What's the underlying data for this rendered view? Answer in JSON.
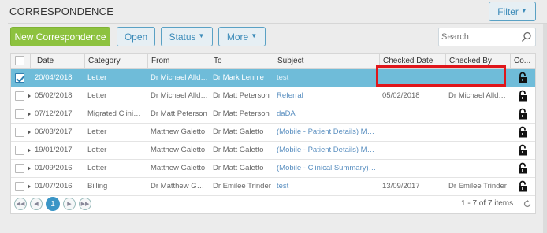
{
  "panel": {
    "title": "CORRESPONDENCE"
  },
  "toolbar": {
    "filter_label": "Filter",
    "new_label": "New Correspondence",
    "open_label": "Open",
    "status_label": "Status",
    "more_label": "More"
  },
  "search": {
    "placeholder": "Search",
    "value": ""
  },
  "table": {
    "columns": [
      "Date",
      "Category",
      "From",
      "To",
      "Subject",
      "Checked Date",
      "Checked By",
      "Co..."
    ],
    "rows": [
      {
        "date": "20/04/2018",
        "category": "Letter",
        "from": "Dr Michael Alldrick",
        "to": "Dr Mark Lennie",
        "subject": "test",
        "checked_date": "",
        "checked_by": "",
        "selected": true
      },
      {
        "date": "05/02/2018",
        "category": "Letter",
        "from": "Dr Michael Alldrick",
        "to": "Dr Matt Peterson",
        "subject": "Referral",
        "checked_date": "05/02/2018",
        "checked_by": "Dr Michael Alldrick",
        "selected": false
      },
      {
        "date": "07/12/2017",
        "category": "Migrated Clinical ...",
        "from": "Dr Matt Peterson",
        "to": "Dr Matt Peterson",
        "subject": "daDA",
        "checked_date": "",
        "checked_by": "",
        "selected": false
      },
      {
        "date": "06/03/2017",
        "category": "Letter",
        "from": "Matthew Galetto",
        "to": "Dr Matt Galetto",
        "subject": "(Mobile - Patient Details) Mobile....",
        "checked_date": "",
        "checked_by": "",
        "selected": false
      },
      {
        "date": "19/01/2017",
        "category": "Letter",
        "from": "Matthew Galetto",
        "to": "Dr Matt Galetto",
        "subject": "(Mobile - Patient Details) Mobile....",
        "checked_date": "",
        "checked_by": "",
        "selected": false
      },
      {
        "date": "01/09/2016",
        "category": "Letter",
        "from": "Matthew Galetto",
        "to": "Dr Matt Galetto",
        "subject": "(Mobile - Clinical Summary) Mo...",
        "checked_date": "",
        "checked_by": "",
        "selected": false
      },
      {
        "date": "01/07/2016",
        "category": "Billing",
        "from": "Dr Matthew Gale...",
        "to": "Dr Emilee Trinder",
        "subject": "test",
        "checked_date": "13/09/2017",
        "checked_by": "Dr Emilee Trinder",
        "selected": false
      }
    ]
  },
  "pager": {
    "current_page": "1",
    "info": "1 - 7 of 7 items"
  },
  "colors": {
    "accent_green": "#8dc23f",
    "selected_row": "#6fbcd9",
    "highlight_red": "#e0161b",
    "link_blue": "#5a8fc0"
  },
  "icons": [
    "chevron-down-icon",
    "search-icon",
    "lock-icon",
    "expand-arrow-icon",
    "first-page-icon",
    "prev-page-icon",
    "next-page-icon",
    "last-page-icon",
    "refresh-icon",
    "checkbox-icon"
  ]
}
